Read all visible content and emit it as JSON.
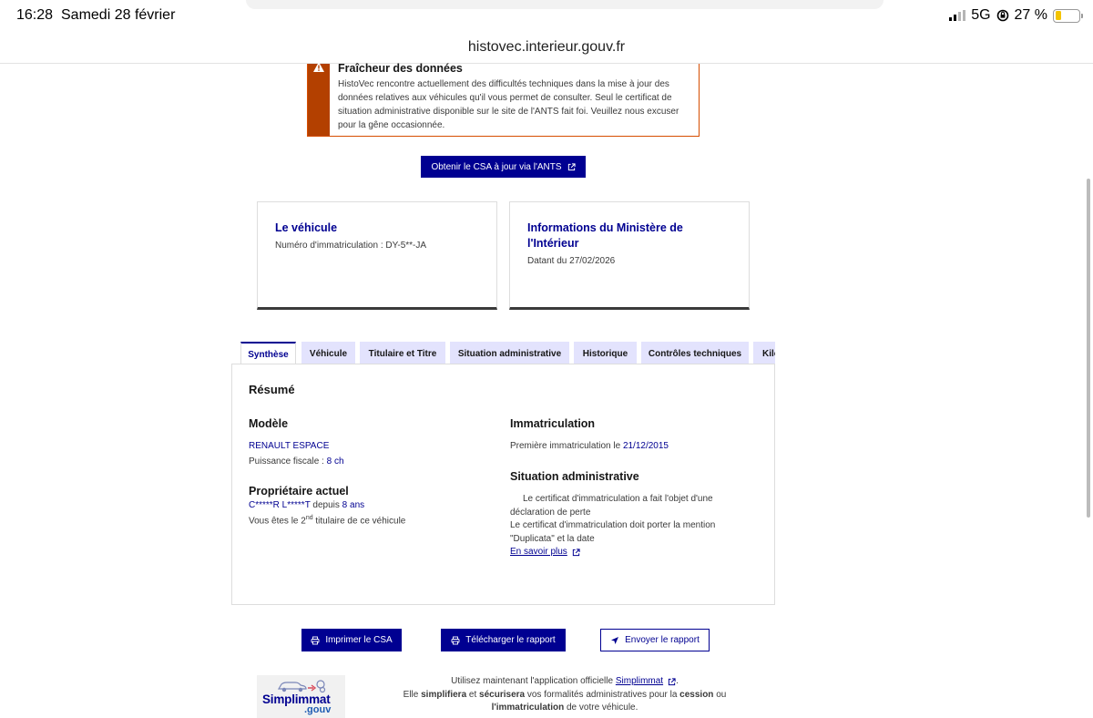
{
  "status_bar": {
    "time": "16:28",
    "date": "Samedi 28 février",
    "network": "5G",
    "battery": "27 %",
    "battery_level": 0.27
  },
  "browser": {
    "url": "histovec.interieur.gouv.fr"
  },
  "alert": {
    "title": "Fraîcheur des données",
    "text": "HistoVec rencontre actuellement des difficultés techniques dans la mise à jour des données relatives aux véhicules qu'il vous permet de consulter. Seul le certificat de situation administrative disponible sur le site de l'ANTS fait foi. Veuillez nous excuser pour la gêne occasionnée.",
    "color": "#b34000"
  },
  "csa_button": {
    "label": "Obtenir le CSA à jour via l'ANTS"
  },
  "cards": {
    "vehicle": {
      "title": "Le véhicule",
      "desc": "Numéro d'immatriculation : DY-5**-JA"
    },
    "ministere": {
      "title": "Informations du Ministère de l'Intérieur",
      "desc": "Datant du 27/02/2026"
    }
  },
  "tabs": [
    {
      "label": "Synthèse",
      "active": true
    },
    {
      "label": "Véhicule"
    },
    {
      "label": "Titulaire et Titre"
    },
    {
      "label": "Situation administrative"
    },
    {
      "label": "Historique"
    },
    {
      "label": "Contrôles techniques"
    },
    {
      "label": "Kilo"
    }
  ],
  "synthese": {
    "title": "Résumé",
    "modele": {
      "heading": "Modèle",
      "name": "RENAULT ESPACE",
      "puissance_label": "Puissance fiscale : ",
      "puissance_value": "8 ch"
    },
    "proprietaire": {
      "heading": "Propriétaire actuel",
      "name": "C*****R L*****T",
      "since_word": " depuis ",
      "since_value": "8 ans",
      "rank_prefix": "Vous êtes le 2",
      "rank_sup": "nd",
      "rank_suffix": " titulaire de ce véhicule"
    },
    "immatriculation": {
      "heading": "Immatriculation",
      "label": "Première immatriculation le ",
      "date": "21/12/2015"
    },
    "situation": {
      "heading": "Situation administrative",
      "line1": "Le certificat d'immatriculation a fait l'objet d'une déclaration de perte",
      "line2": "Le certificat d'immatriculation doit porter la mention \"Duplicata\" et la date",
      "link": "En savoir plus"
    }
  },
  "actions": {
    "print": "Imprimer le CSA",
    "download": "Télécharger le rapport",
    "send": "Envoyer le rapport"
  },
  "footer": {
    "logo_text": "Simplimmat",
    "logo_suffix": ".gouv",
    "line1_prefix": "Utilisez maintenant l'application officielle ",
    "line1_link": "Simplimmat",
    "line1_suffix": ".",
    "line2_a": "Elle ",
    "line2_b": "simplifiera",
    "line2_c": " et ",
    "line2_d": "sécurisera",
    "line2_e": " vos formalités administratives pour la ",
    "line2_f": "cession",
    "line2_g": " ou",
    "line3_a": "l'immatriculation",
    "line3_b": " de votre véhicule."
  }
}
